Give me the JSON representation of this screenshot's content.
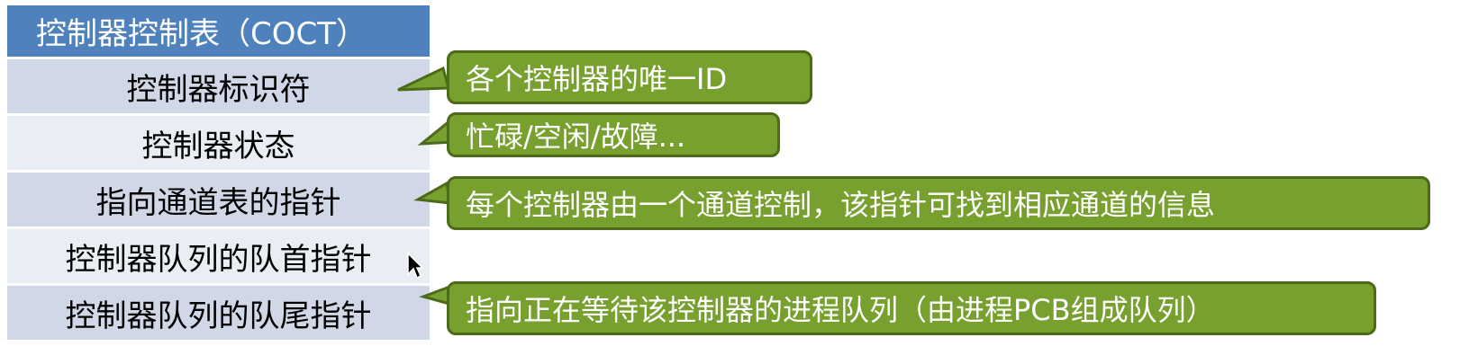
{
  "table": {
    "header": "控制器控制表（COCT）",
    "rows": [
      "控制器标识符",
      "控制器状态",
      "指向通道表的指针",
      "控制器队列的队首指针",
      "控制器队列的队尾指针"
    ]
  },
  "callouts": [
    "各个控制器的唯一ID",
    "忙碌/空闲/故障...",
    "每个控制器由一个通道控制，该指针可找到相应通道的信息",
    "指向正在等待该控制器的进程队列（由进程PCB组成队列）"
  ],
  "colors": {
    "header": "#4f81bd",
    "row_dark": "#d0d8e8",
    "row_light": "#e9edf4",
    "callout_fill": "#77a02e",
    "callout_border": "#4c6a19"
  },
  "icons": {
    "cursor": "mouse-pointer-icon"
  }
}
